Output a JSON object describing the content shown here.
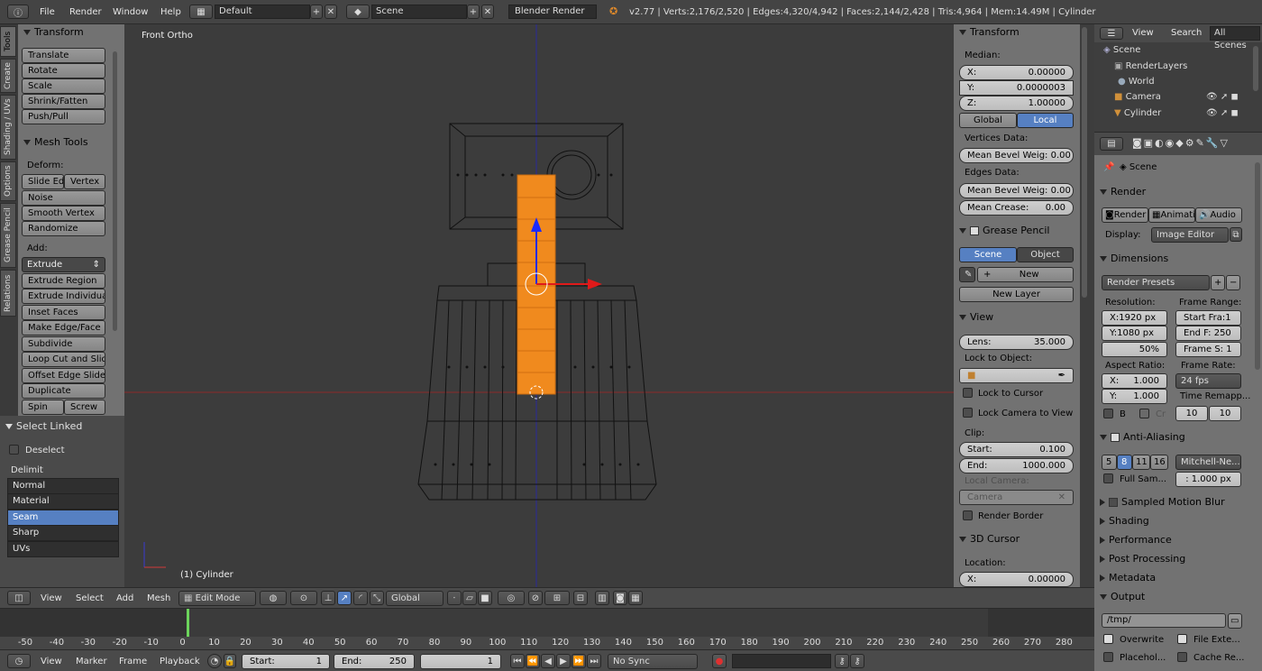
{
  "topbar": {
    "menus": [
      "File",
      "Render",
      "Window",
      "Help"
    ],
    "screen_layout": "Default",
    "scene": "Scene",
    "engine": "Blender Render",
    "stats": "v2.77 | Verts:2,176/2,520 | Edges:4,320/4,942 | Faces:2,144/2,428 | Tris:4,964 | Mem:14.49M | Cylinder"
  },
  "tool_tabs": [
    "Tools",
    "Create",
    "Shading / UVs",
    "Options",
    "Grease Pencil",
    "Relations"
  ],
  "tool_shelf": {
    "transform_title": "Transform",
    "transform_buttons": [
      "Translate",
      "Rotate",
      "Scale",
      "Shrink/Fatten",
      "Push/Pull"
    ],
    "mesh_tools_title": "Mesh Tools",
    "deform_label": "Deform:",
    "slide_edge": "Slide Ed",
    "vertex": "Vertex",
    "deform_buttons": [
      "Noise",
      "Smooth Vertex",
      "Randomize"
    ],
    "add_label": "Add:",
    "extrude": "Extrude",
    "add_buttons": [
      "Extrude Region",
      "Extrude Individual",
      "Inset Faces",
      "Make Edge/Face",
      "Subdivide",
      "Loop Cut and Slide",
      "Offset Edge Slide",
      "Duplicate"
    ],
    "spin": "Spin",
    "screw": "Screw"
  },
  "operator_panel": {
    "title": "Select Linked",
    "deselect": "Deselect",
    "delimit_label": "Delimit",
    "delimit_options": [
      "Normal",
      "Material",
      "Seam",
      "Sharp",
      "UVs"
    ],
    "selected": "Seam"
  },
  "viewport": {
    "view_label": "Front Ortho",
    "object_label": "(1) Cylinder"
  },
  "n_panel": {
    "transform_title": "Transform",
    "median_label": "Median:",
    "x_label": "X:",
    "x_value": "0.00000",
    "y_label": "Y:",
    "y_value": "0.0000003",
    "z_label": "Z:",
    "z_value": "1.00000",
    "global": "Global",
    "local": "Local",
    "vertices_data": "Vertices Data:",
    "mean_bevel_v": "Mean Bevel Weig: 0.00",
    "edges_data": "Edges Data:",
    "mean_bevel_e": "Mean Bevel Weig: 0.00",
    "mean_crease_label": "Mean Crease:",
    "mean_crease_value": "0.00",
    "grease_title": "Grease Pencil",
    "gp_scene": "Scene",
    "gp_object": "Object",
    "gp_new": "New",
    "gp_new_layer": "New Layer",
    "view_title": "View",
    "lens_label": "Lens:",
    "lens_value": "35.000",
    "lock_to_object": "Lock to Object:",
    "lock_to_cursor": "Lock to Cursor",
    "lock_camera": "Lock Camera to View",
    "clip_label": "Clip:",
    "clip_start_label": "Start:",
    "clip_start": "0.100",
    "clip_end_label": "End:",
    "clip_end": "1000.000",
    "local_camera": "Local Camera:",
    "camera": "Camera",
    "render_border": "Render Border",
    "cursor_title": "3D Cursor",
    "location_label": "Location:",
    "cursor_x_label": "X:",
    "cursor_x": "0.00000"
  },
  "outliner": {
    "view": "View",
    "search": "Search",
    "all_scenes": "All Scenes",
    "items": [
      "Scene",
      "RenderLayers",
      "World",
      "Camera",
      "Cylinder"
    ]
  },
  "properties": {
    "scene": "Scene",
    "render_title": "Render",
    "render_btn": "Render",
    "anim_btn": "Animati",
    "audio_btn": "Audio",
    "display_label": "Display:",
    "display_value": "Image Editor",
    "dimensions_title": "Dimensions",
    "render_presets": "Render Presets",
    "resolution_label": "Resolution:",
    "frame_range_label": "Frame Range:",
    "res_x": "X:1920 px",
    "res_y": "Y:1080 px",
    "res_pct": "50%",
    "start_frame": "Start Fra:1",
    "end_frame": "End F: 250",
    "frame_step": "Frame S: 1",
    "aspect_label": "Aspect Ratio:",
    "frame_rate_label": "Frame Rate:",
    "aspect_x_label": "X:",
    "aspect_x": "1.000",
    "aspect_y_label": "Y:",
    "aspect_y": "1.000",
    "fps": "24 fps",
    "time_remap": "Time Remapp...",
    "b_label": "B",
    "cr_label": "Cr",
    "remap_old": "10",
    "remap_new": "10",
    "aa_title": "Anti-Aliasing",
    "aa_samples": [
      "5",
      "8",
      "11",
      "16"
    ],
    "aa_selected": "8",
    "aa_filter": "Mitchell-Ne...",
    "full_sample": "Full Sam...",
    "filter_size": ": 1.000 px",
    "motion_blur": "Sampled Motion Blur",
    "collapsed_panels": [
      "Shading",
      "Performance",
      "Post Processing",
      "Metadata"
    ],
    "output_title": "Output",
    "output_path": "/tmp/",
    "overwrite": "Overwrite",
    "file_ext": "File Exte...",
    "placeholders": "Placehol...",
    "cache": "Cache Re..."
  },
  "viewport_header": {
    "menus": [
      "View",
      "Select",
      "Add",
      "Mesh"
    ],
    "mode": "Edit Mode",
    "orientation": "Global"
  },
  "timeline": {
    "ticks": [
      "-50",
      "-40",
      "-30",
      "-20",
      "-10",
      "0",
      "10",
      "20",
      "30",
      "40",
      "50",
      "60",
      "70",
      "80",
      "90",
      "100",
      "110",
      "120",
      "130",
      "140",
      "150",
      "160",
      "170",
      "180",
      "190",
      "200",
      "210",
      "220",
      "230",
      "240",
      "250",
      "260",
      "270",
      "280"
    ],
    "current_frame": "1"
  },
  "timeline_header": {
    "menus": [
      "View",
      "Marker",
      "Frame",
      "Playback"
    ],
    "start_label": "Start:",
    "start": "1",
    "end_label": "End:",
    "end": "250",
    "current": "1",
    "sync": "No Sync"
  },
  "colors": {
    "selection_orange": "#f08a1e",
    "accent_blue": "#5680c2",
    "x_axis": "#9a2a2a",
    "z_axis": "#2a2a9a"
  }
}
